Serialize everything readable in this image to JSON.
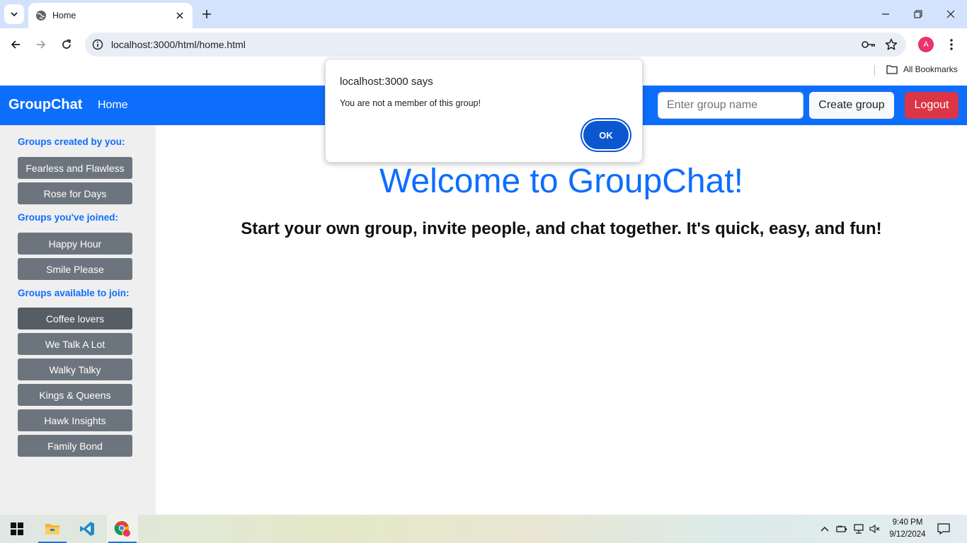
{
  "browser": {
    "tab_title": "Home",
    "url": "localhost:3000/html/home.html",
    "profile_initial": "A",
    "bookmarks_label": "All Bookmarks"
  },
  "navbar": {
    "brand": "GroupChat",
    "home_link": "Home",
    "group_input_placeholder": "Enter group name",
    "create_button": "Create group",
    "logout_button": "Logout"
  },
  "sidebar": {
    "created_title": "Groups created by you:",
    "created_groups": [
      "Fearless and Flawless",
      "Rose for Days"
    ],
    "joined_title": "Groups you've joined:",
    "joined_groups": [
      "Happy Hour",
      "Smile Please"
    ],
    "available_title": "Groups available to join:",
    "available_groups": [
      "Coffee lovers",
      "We Talk A Lot",
      "Walky Talky",
      "Kings & Queens",
      "Hawk Insights",
      "Family Bond"
    ]
  },
  "main": {
    "welcome": "Welcome to GroupChat!",
    "subtitle": "Start your own group, invite people, and chat together. It's quick, easy, and fun!"
  },
  "dialog": {
    "title": "localhost:3000 says",
    "message": "You are not a member of this group!",
    "ok_button": "OK"
  },
  "taskbar": {
    "time": "9:40 PM",
    "date": "9/12/2024"
  },
  "colors": {
    "navbar": "#0d6efd",
    "logout": "#dc3545",
    "group_button": "#6c757d",
    "dialog_ok": "#0b57d0"
  }
}
